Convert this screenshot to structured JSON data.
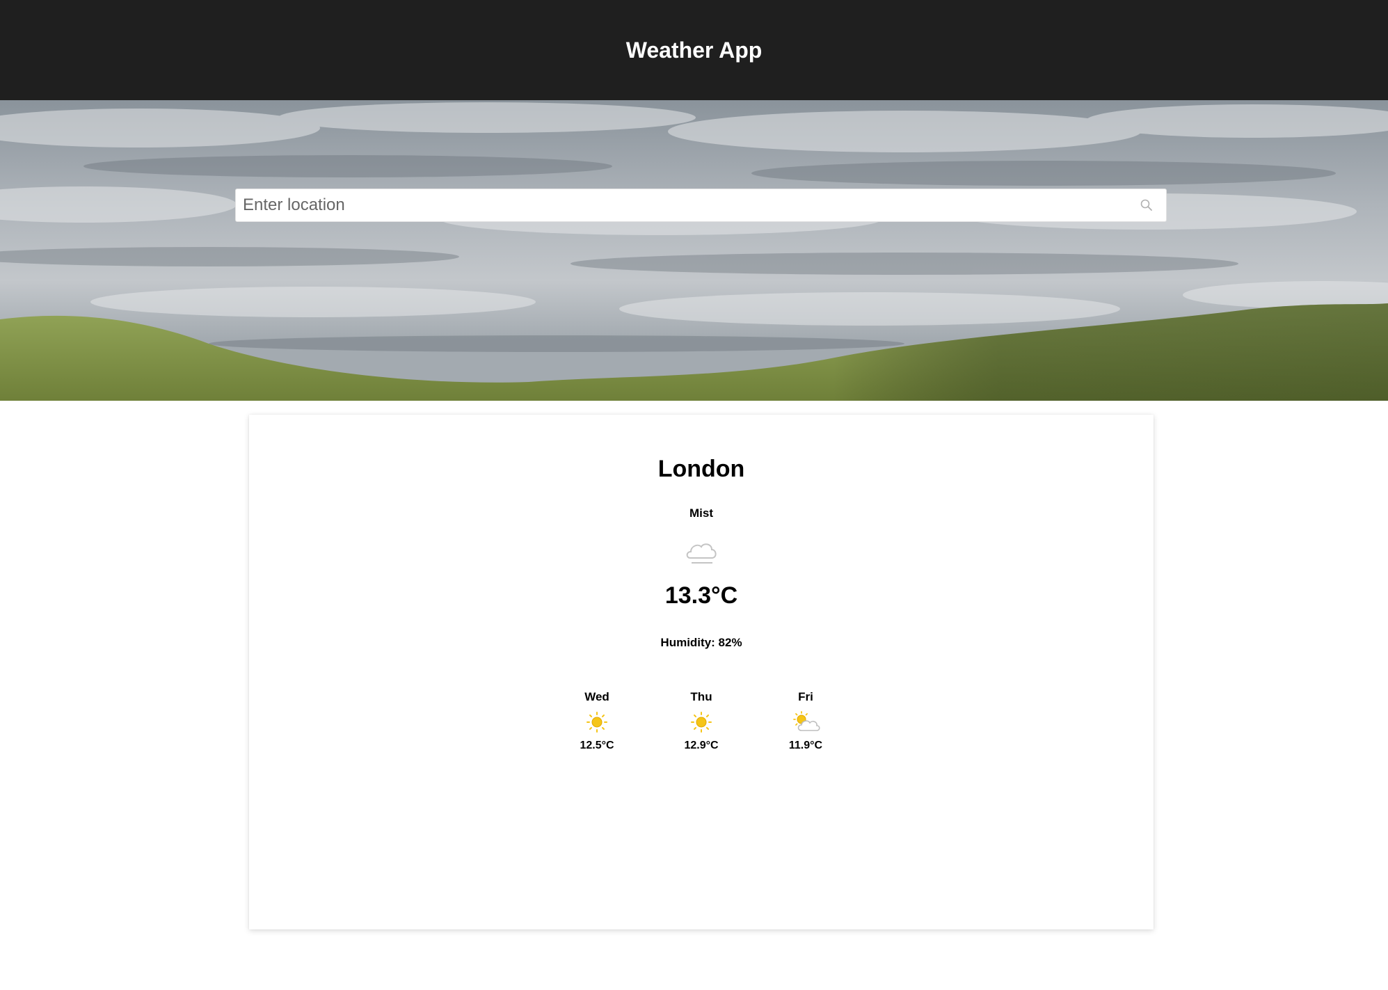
{
  "header": {
    "title": "Weather App"
  },
  "search": {
    "placeholder": "Enter location",
    "value": "",
    "icon": "search-icon"
  },
  "current": {
    "city": "London",
    "condition": "Mist",
    "condition_icon": "mist-icon",
    "temperature": "13.3°C",
    "humidity": "Humidity: 82%"
  },
  "forecast": [
    {
      "day": "Wed",
      "icon": "sunny-icon",
      "temp": "12.5°C"
    },
    {
      "day": "Thu",
      "icon": "sunny-icon",
      "temp": "12.9°C"
    },
    {
      "day": "Fri",
      "icon": "partly-cloudy-icon",
      "temp": "11.9°C"
    }
  ],
  "colors": {
    "header_bg": "#1f1f1f",
    "header_text": "#ffffff",
    "sun": "#f5c518",
    "cloud_outline": "#bdbdbd"
  }
}
